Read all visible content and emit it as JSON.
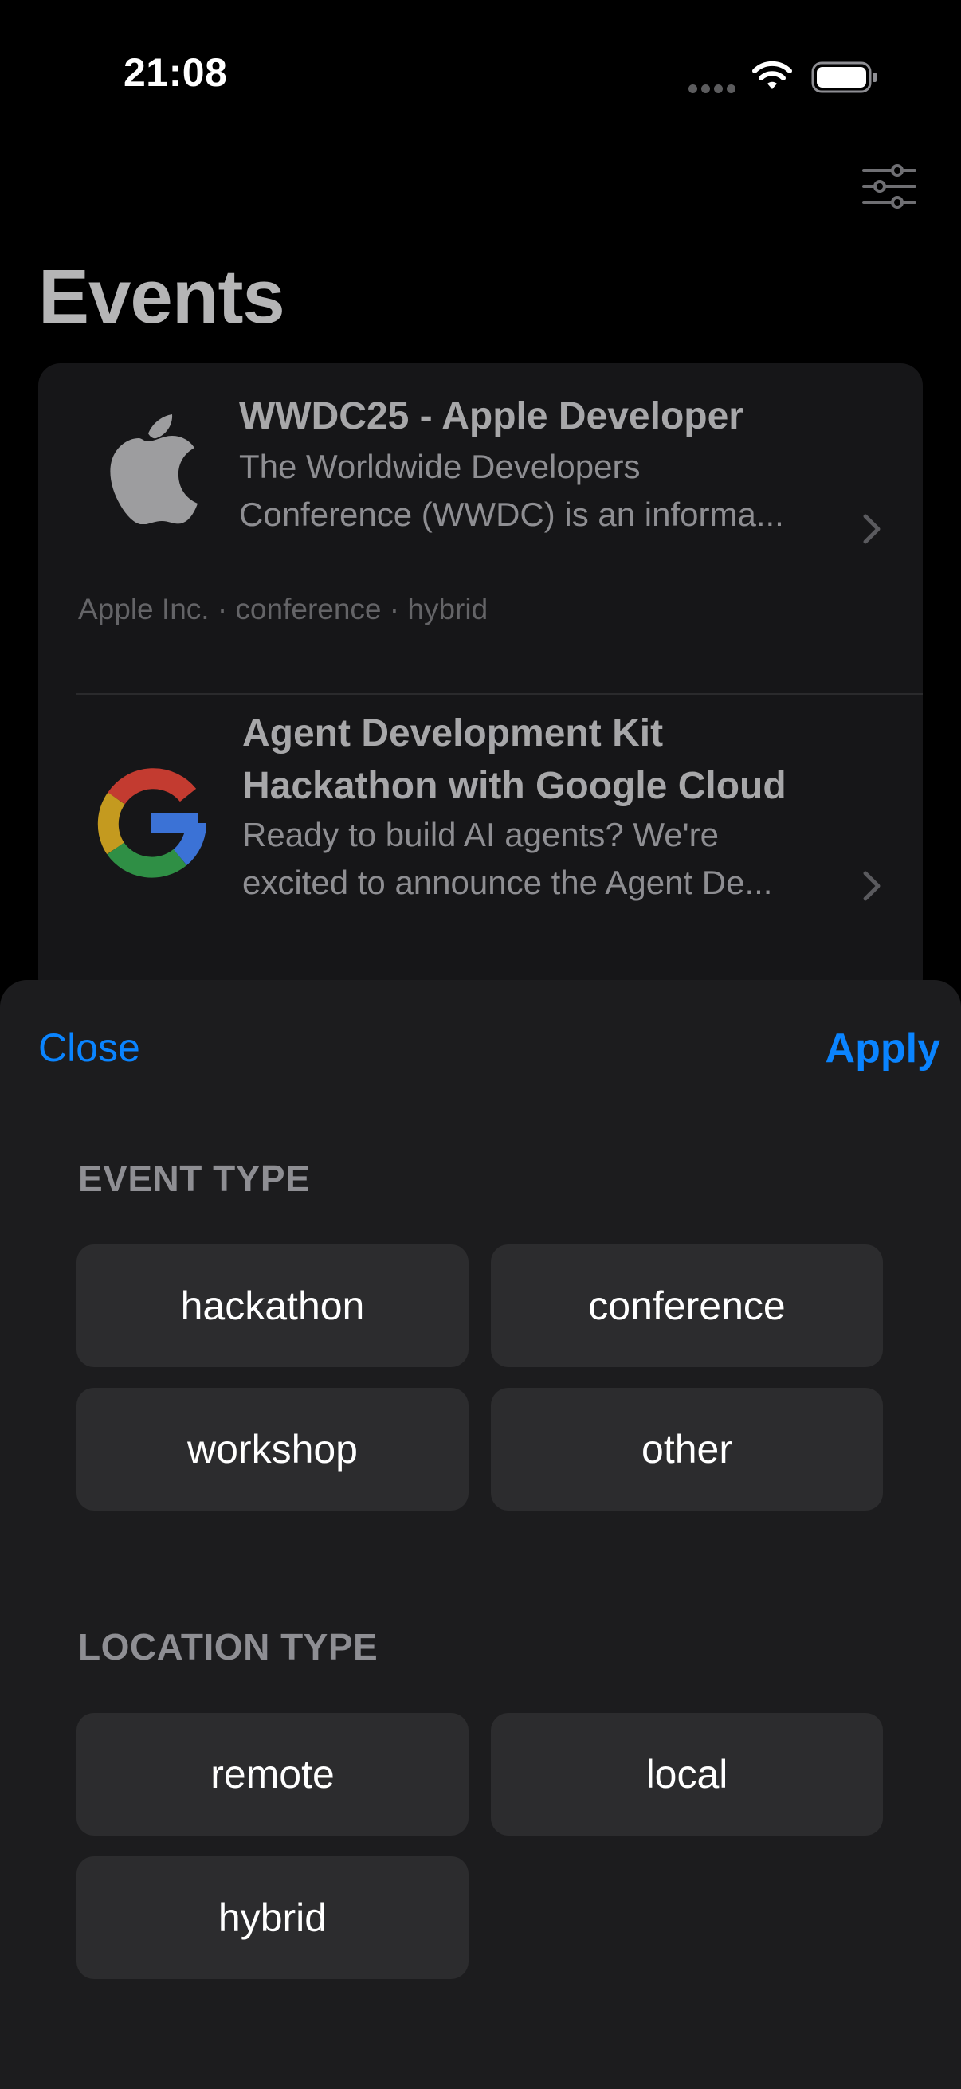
{
  "status_bar": {
    "time": "21:08"
  },
  "header": {
    "title": "Events",
    "filter_icon": "sliders-icon"
  },
  "events": [
    {
      "title_lines": [
        "WWDC25 - Apple Developer"
      ],
      "description_lines": [
        "The Worldwide Developers",
        "Conference (WWDC) is an informa..."
      ],
      "meta": "Apple Inc. · conference · hybrid",
      "logo": "apple-logo"
    },
    {
      "title_lines": [
        "Agent Development Kit",
        "Hackathon with Google Cloud"
      ],
      "description_lines": [
        "Ready to build AI agents? We're",
        "excited to announce the Agent De..."
      ],
      "logo": "google-logo"
    }
  ],
  "sheet": {
    "close_label": "Close",
    "apply_label": "Apply",
    "event_type": {
      "label": "EVENT TYPE",
      "options": [
        "hackathon",
        "conference",
        "workshop",
        "other"
      ]
    },
    "location_type": {
      "label": "LOCATION TYPE",
      "options": [
        "remote",
        "local",
        "hybrid"
      ]
    }
  },
  "colors": {
    "accent": "#0a84ff",
    "sheet_background": "#1c1c1e",
    "chip_background": "#2c2c2e"
  }
}
